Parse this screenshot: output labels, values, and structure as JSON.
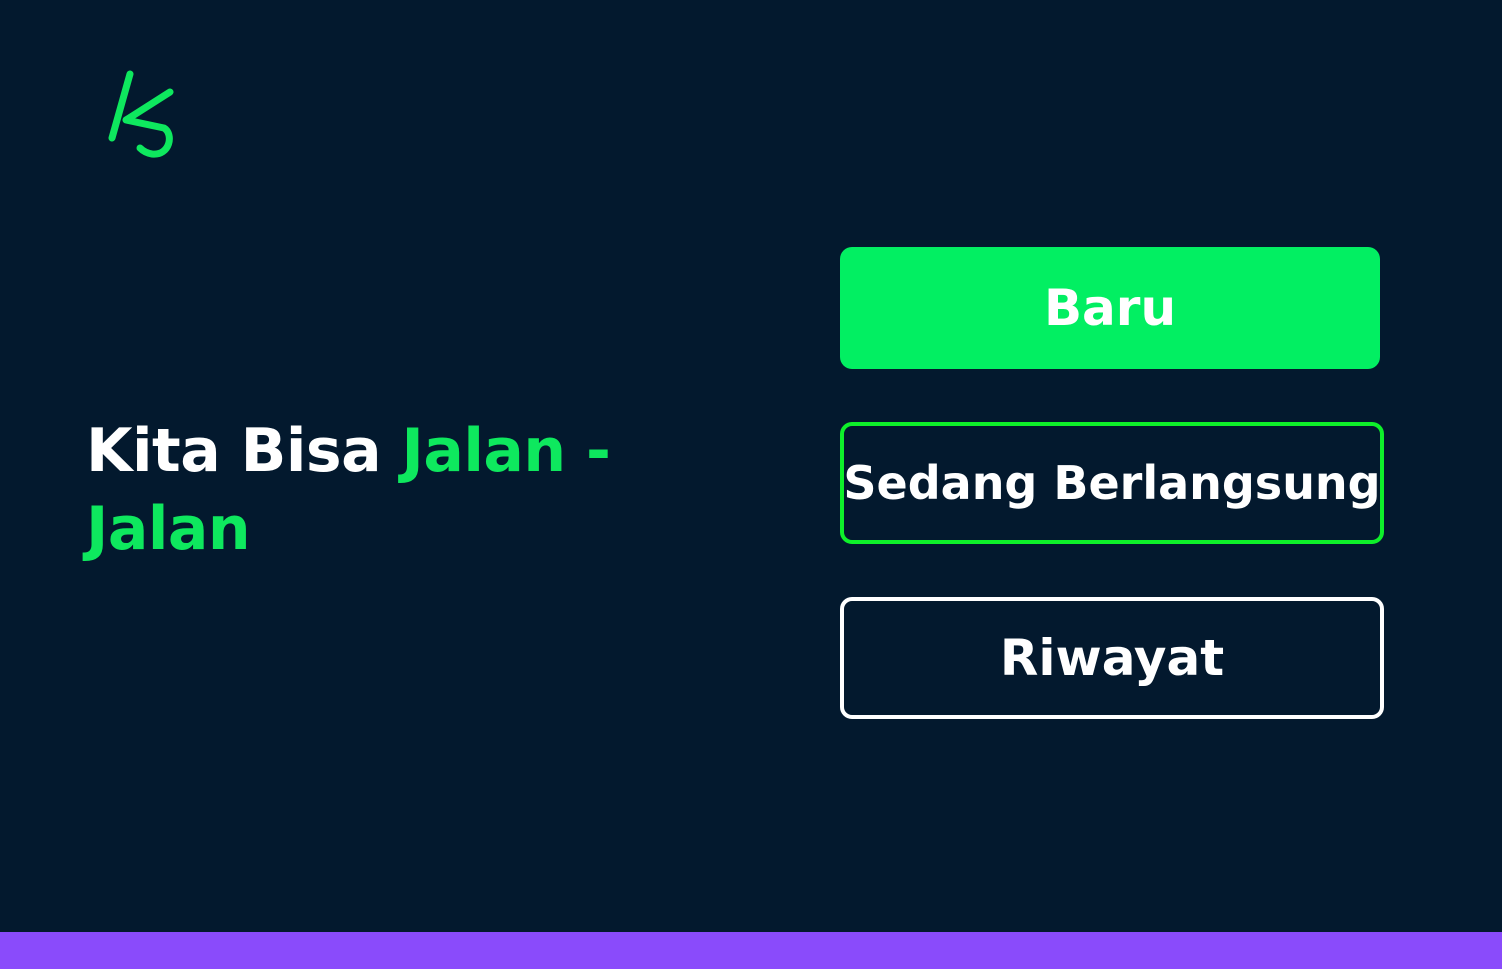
{
  "logo": {
    "icon": "ks-monogram-logo",
    "color": "#0ee85e"
  },
  "tagline": {
    "part1": "Kita Bisa ",
    "part2": "Jalan - Jalan"
  },
  "buttons": {
    "new_label": "Baru",
    "ongoing_label": "Sedang Berlangsung",
    "history_label": "Riwayat"
  },
  "colors": {
    "background": "#03192e",
    "accent": "#0ee85e",
    "primary_button": "#02ef62",
    "ongoing_border": "#0ef02a",
    "history_border": "#ffffff",
    "footer_bar": "#8a4bfb"
  }
}
